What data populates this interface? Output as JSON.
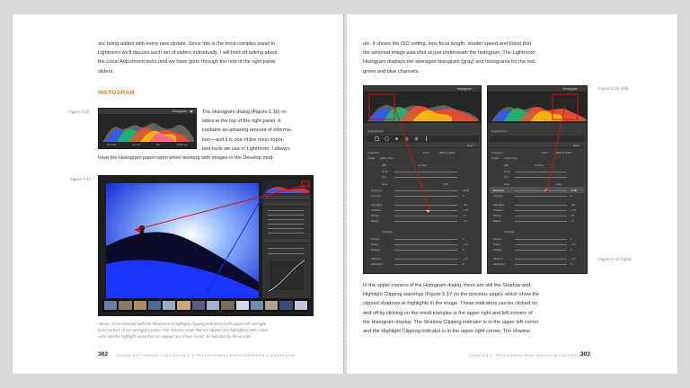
{
  "left_page": {
    "intro_lines": [
      "are being added with every new update. Since this is the most complex panel in",
      "Lightroom we'll discuss each set of sliders individually. I will hold off talking about",
      "the Local Adjustment tools until we have gone through the rest of the right panel",
      "sliders."
    ],
    "heading": "HISTOGRAM",
    "figure_516_label": "Figure 5.16",
    "histogram_panel_title": "Histogram",
    "histogram_readout": [
      "ISO 100",
      "24 mm",
      "f/11",
      "1/160 sec"
    ],
    "body_lines_right": [
      "The Histogram dialog (Figure 5.16) re-",
      "sides at the top of the right panel. It",
      "contains an amazing amount of informa-",
      "tion—and it is one of the most impor-",
      "tant tools we use in Lightroom. I always"
    ],
    "body_line_full": "have the Histogram panel open when working with images in the Develop mod-",
    "figure_517_label": "Figure 5.17",
    "caption_lines": [
      "Above I have selected both the Shadow and Highlight Clipping indicators in the upper left and right",
      "hand corners of the Histogram panel. The shadow areas that are clipped are highlighted with a blue",
      "color and the highlight areas that are clipped are shown in red, as indicated by the arrows."
    ],
    "page_number": "302",
    "running_footer": "ADOBE PHOTOSHOP LIGHTROOM 4: A PROFESSIONAL PHOTOGRAPHER'S WORKFLOW"
  },
  "right_page": {
    "intro_lines": [
      "ule. It shows the ISO setting, lens focal length, shutter speed and f/stop that",
      "the selected image was shot at just underneath the histogram. The Lightroom",
      "Histogram displays the averaged histogram (gray) and histograms for the red,",
      "green and blue channels."
    ],
    "figure_518_label": "Figure 5.18 (left)",
    "figure_519_label": "Figure 5.19 (right)",
    "panel_left": {
      "title": "Histogram",
      "basic_label": "Basic",
      "treatment_label": "Treatment:",
      "treatment_options": [
        "Color",
        "Black & White"
      ],
      "profile_label": "Profile:",
      "profile_value": "Adobe Color",
      "wb_label": "WB:",
      "wb_value": "As Shot",
      "temp_label": "Temp",
      "tint_label": "Tint",
      "tone_label": "Tone",
      "auto_label": "Auto",
      "sliders": [
        "Exposure",
        "Contrast",
        "Highlights",
        "Shadows",
        "Whites",
        "Blacks"
      ],
      "values": [
        "+0.00",
        "0",
        "- 35",
        "+ 18",
        "+ 8",
        "- 12"
      ],
      "presence_label": "Presence",
      "presence_sliders": [
        "Texture",
        "Clarity",
        "Dehaze",
        "Vibrance",
        "Saturation"
      ],
      "presence_values": [
        "0",
        "+ 12",
        "0",
        "+ 10",
        "0"
      ],
      "original_photo": "Original Photo"
    },
    "panel_right": {
      "title": "Histogram",
      "basic_label": "Basic",
      "treatment_label": "Treatment:",
      "treatment_options": [
        "Color",
        "Black & White"
      ],
      "profile_label": "Profile:",
      "profile_value": "Adobe Color",
      "wb_label": "WB:",
      "wb_value": "As Shot",
      "temp_label": "Temp",
      "tint_label": "Tint",
      "tone_label": "Tone",
      "auto_label": "Auto",
      "sliders": [
        "Exposure",
        "Contrast",
        "Highlights",
        "Shadows",
        "Whites",
        "Blacks"
      ],
      "values": [
        "+0.85",
        "0",
        "- 40",
        "+ 22",
        "+ 5",
        "- 8"
      ],
      "presence_label": "Presence",
      "presence_sliders": [
        "Texture",
        "Clarity",
        "Dehaze",
        "Vibrance",
        "Saturation"
      ],
      "presence_values": [
        "0",
        "+ 15",
        "0",
        "+ 12",
        "0"
      ],
      "original_photo": "Original Photo"
    },
    "body_lines": [
      "In the upper corners of the Histogram dialog, there are still the Shadow and",
      "Highlight Clipping warnings (Figure 5.17 on the previous page), which show the",
      "clipped shadows or highlights in the image. These indicators can be clicked on",
      "and off by clicking on the small triangles in the upper right and left corners of",
      "the Histogram display. The Shadow Clipping indicator is in the upper left corner",
      "and the Highlight Clipping indicator is in the upper right corner. The shadow"
    ],
    "page_number": "303",
    "running_footer": "CHAPTER 5: PROCESSING RAW IMAGES IN LIGHTROOM"
  },
  "colors": {
    "accent": "#e2791d",
    "shadow_clip": "#1a35ff",
    "highlight_clip": "#ff1a1a",
    "arrow_red": "#e01010",
    "arrow_blue": "#1a2ee0"
  }
}
